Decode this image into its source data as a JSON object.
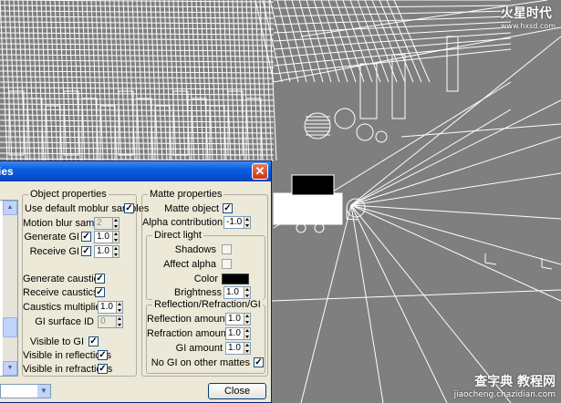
{
  "dialog": {
    "title_fragment": "ies",
    "close_glyph": "✕",
    "close_button": "Close"
  },
  "watermark": {
    "top_brand": "火星时代",
    "top_url": "www.hxsd.com",
    "bottom_brand": "查字典 教程网",
    "bottom_url": "jiaocheng.chazidian.com"
  },
  "object_properties": {
    "legend": "Object properties",
    "use_default_moblur": {
      "label": "Use default moblur samples",
      "checked": true
    },
    "motion_blur_samples": {
      "label": "Motion blur samples",
      "value": "2"
    },
    "generate_gi": {
      "label": "Generate GI",
      "checked": true,
      "value": "1.0"
    },
    "receive_gi": {
      "label": "Receive GI",
      "checked": true,
      "value": "1.0"
    },
    "generate_caustics": {
      "label": "Generate caustics",
      "checked": true
    },
    "receive_caustics": {
      "label": "Receive caustics",
      "checked": true
    },
    "caustics_multiplier": {
      "label": "Caustics multiplier",
      "value": "1.0"
    },
    "gi_surface_id": {
      "label": "GI surface ID",
      "value": "0"
    },
    "visible_to_gi": {
      "label": "Visible to GI",
      "checked": true
    },
    "visible_in_reflections": {
      "label": "Visible in reflections",
      "checked": true
    },
    "visible_in_refractions": {
      "label": "Visible in refractions",
      "checked": true
    }
  },
  "matte_properties": {
    "legend": "Matte properties",
    "matte_object": {
      "label": "Matte object",
      "checked": true
    },
    "alpha_contribution": {
      "label": "Alpha contribution",
      "value": "-1.0"
    },
    "direct_light": {
      "legend": "Direct light",
      "shadows": {
        "label": "Shadows",
        "checked": false
      },
      "affect_alpha": {
        "label": "Affect alpha",
        "checked": false
      },
      "color": {
        "label": "Color",
        "hex": "#000000"
      },
      "brightness": {
        "label": "Brightness",
        "value": "1.0"
      }
    },
    "rrg": {
      "legend": "Reflection/Refraction/GI",
      "reflection_amount": {
        "label": "Reflection amount",
        "value": "1.0"
      },
      "refraction_amount": {
        "label": "Refraction amount",
        "value": "1.0"
      },
      "gi_amount": {
        "label": "GI amount",
        "value": "1.0"
      },
      "no_gi_on_other_mattes": {
        "label": "No GI on other mattes",
        "checked": true
      }
    }
  },
  "colors": {
    "viewport_bg": "#7f7f7f",
    "wire": "#ffffff",
    "title_blue": "#0550d0",
    "dialog_bg": "#ece9d8"
  }
}
